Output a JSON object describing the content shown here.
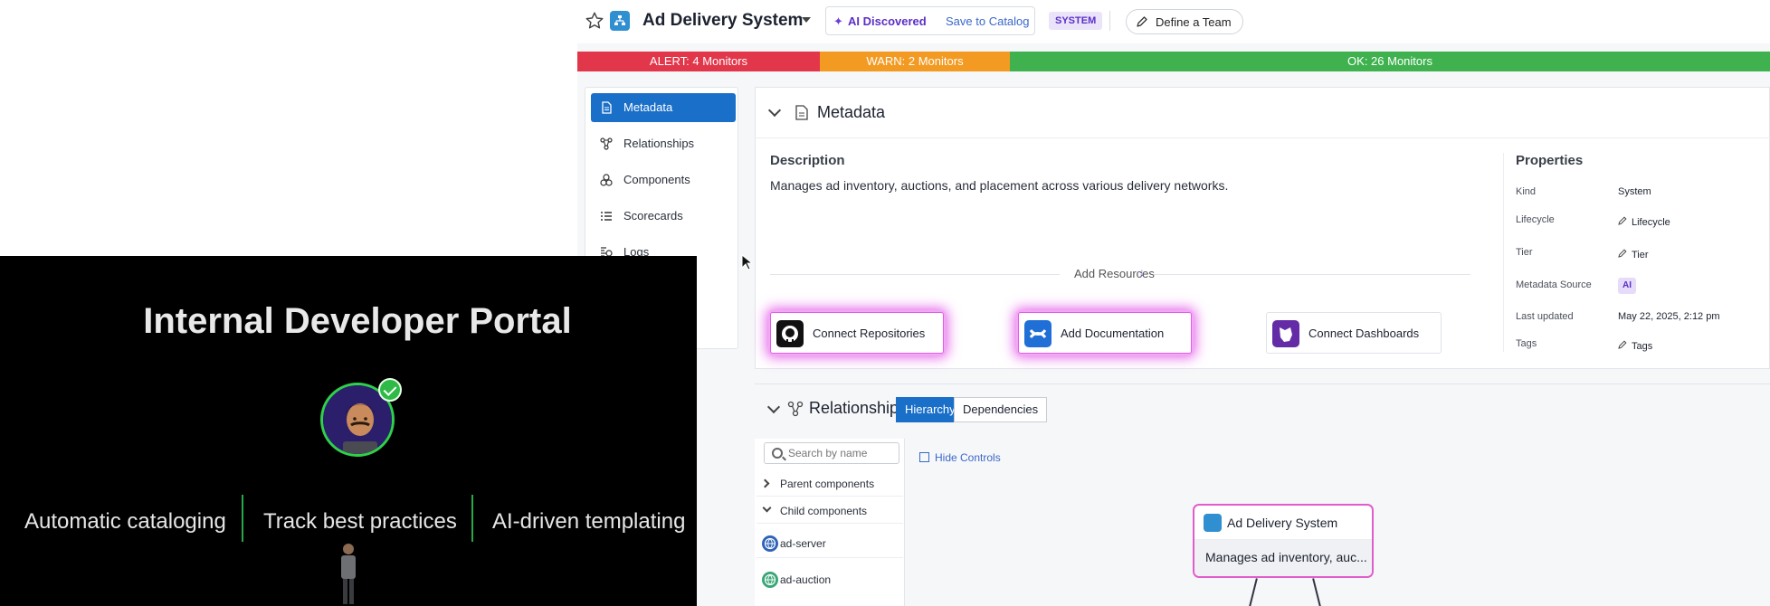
{
  "app": {
    "title": "Ad Delivery System",
    "ai_discovered": "AI Discovered",
    "save_to_catalog": "Save to Catalog",
    "type_badge": "SYSTEM",
    "define_team": "Define a Team"
  },
  "monitors": {
    "alert": "ALERT: 4 Monitors",
    "warn": "WARN: 2 Monitors",
    "ok": "OK: 26 Monitors",
    "colors": {
      "alert": "#e2364a",
      "warn": "#f39a22",
      "ok": "#3fb24f"
    }
  },
  "nav": {
    "items": [
      {
        "label": "Metadata",
        "icon": "document-icon",
        "active": true
      },
      {
        "label": "Relationships",
        "icon": "graph-icon"
      },
      {
        "label": "Components",
        "icon": "components-icon"
      },
      {
        "label": "Scorecards",
        "icon": "list-icon"
      },
      {
        "label": "Logs",
        "icon": "logs-icon"
      }
    ]
  },
  "metadata": {
    "header": "Metadata",
    "description_title": "Description",
    "description": "Manages ad inventory, auctions, and placement across various delivery networks.",
    "add_resources": "Add Resources",
    "resources": [
      {
        "label": "Connect Repositories",
        "icon": "github-icon"
      },
      {
        "label": "Add Documentation",
        "icon": "confluence-icon"
      },
      {
        "label": "Connect Dashboards",
        "icon": "datadog-icon"
      }
    ],
    "properties_title": "Properties",
    "properties": [
      {
        "key": "Kind",
        "value": "System"
      },
      {
        "key": "Lifecycle",
        "value": "Lifecycle"
      },
      {
        "key": "Tier",
        "value": "Tier"
      },
      {
        "key": "Metadata Source",
        "value": "AI"
      },
      {
        "key": "Last updated",
        "value": "May 22, 2025, 2:12 pm"
      },
      {
        "key": "Tags",
        "value": "Tags"
      }
    ]
  },
  "relationships": {
    "header": "Relationships",
    "tabs": [
      "Hierarchy",
      "Dependencies"
    ],
    "search_placeholder": "Search by name",
    "parent_components": "Parent components",
    "child_components": "Child components",
    "children": [
      "ad-server",
      "ad-auction"
    ],
    "hide_controls": "Hide Controls",
    "node_title": "Ad Delivery System",
    "node_desc": "Manages ad inventory, auc..."
  },
  "video": {
    "title": "Internal Developer Portal",
    "features": [
      "Automatic cataloging",
      "Track best practices",
      "AI-driven templating"
    ],
    "accent": "#27a84a"
  }
}
